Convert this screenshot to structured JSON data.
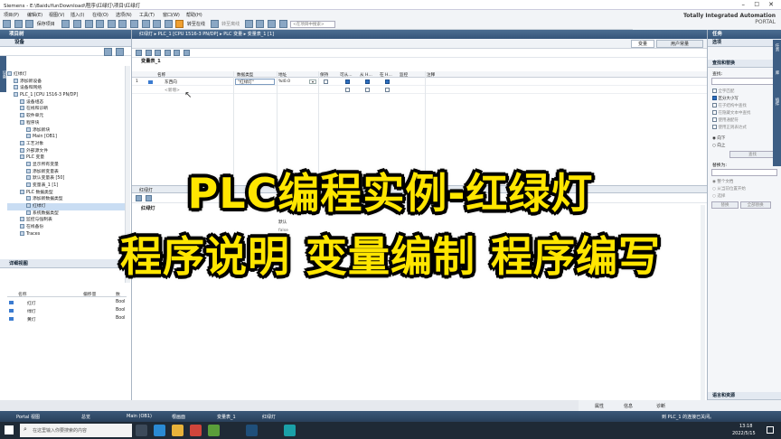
{
  "window": {
    "title": "Siemens  -  E:\\BaiduYunDownload\\程序\\红绿灯\\项目\\红绿灯",
    "brand_line1": "Totally Integrated Automation",
    "brand_line2": "PORTAL"
  },
  "menu": [
    "项目(P)",
    "编辑(E)",
    "视图(V)",
    "插入(I)",
    "在线(O)",
    "选项(N)",
    "工具(T)",
    "窗口(W)",
    "帮助(H)"
  ],
  "toolbar": {
    "save": "保存项目",
    "go_online": "转至在线",
    "go_offline": "转至离线",
    "search_placeholder": "<在项目中搜索>"
  },
  "left_panel": {
    "title": "项目树",
    "devices_label": "设备",
    "side_tab": "设备",
    "tree": [
      {
        "label": "红绿灯",
        "indent": 0,
        "selected": false
      },
      {
        "label": "添加新设备",
        "indent": 1,
        "selected": false
      },
      {
        "label": "设备和网络",
        "indent": 1,
        "selected": false
      },
      {
        "label": "PLC_1 [CPU 1516-3 PN/DP]",
        "indent": 1,
        "selected": false
      },
      {
        "label": "设备组态",
        "indent": 2,
        "selected": false
      },
      {
        "label": "在线和诊断",
        "indent": 2,
        "selected": false
      },
      {
        "label": "软件单元",
        "indent": 2,
        "selected": false
      },
      {
        "label": "程序块",
        "indent": 2,
        "selected": false
      },
      {
        "label": "添加新块",
        "indent": 3,
        "selected": false
      },
      {
        "label": "Main [OB1]",
        "indent": 3,
        "selected": false
      },
      {
        "label": "工艺对象",
        "indent": 2,
        "selected": false
      },
      {
        "label": "外部源文件",
        "indent": 2,
        "selected": false
      },
      {
        "label": "PLC 变量",
        "indent": 2,
        "selected": false
      },
      {
        "label": "显示所有变量",
        "indent": 3,
        "selected": false
      },
      {
        "label": "添加新变量表",
        "indent": 3,
        "selected": false
      },
      {
        "label": "默认变量表 [50]",
        "indent": 3,
        "selected": false
      },
      {
        "label": "变量表_1 [1]",
        "indent": 3,
        "selected": false
      },
      {
        "label": "PLC 数据类型",
        "indent": 2,
        "selected": false
      },
      {
        "label": "添加新数据类型",
        "indent": 3,
        "selected": false
      },
      {
        "label": "红绿灯",
        "indent": 3,
        "selected": true
      },
      {
        "label": "系统数据类型",
        "indent": 3,
        "selected": false
      },
      {
        "label": "监控与强制表",
        "indent": 2,
        "selected": false
      },
      {
        "label": "在线备份",
        "indent": 2,
        "selected": false
      },
      {
        "label": "Traces",
        "indent": 2,
        "selected": false
      }
    ],
    "details_title": "详细视图",
    "details_headers": [
      "名称",
      "偏移量",
      "数"
    ],
    "details_rows": [
      {
        "name": "红灯",
        "type": "Bool"
      },
      {
        "name": "绿灯",
        "type": "Bool"
      },
      {
        "name": "黄灯",
        "type": "Bool"
      }
    ]
  },
  "editor": {
    "breadcrumb": "红绿灯  ▸  PLC_1 [CPU 1516-3 PN/DP]  ▸  PLC 变量  ▸  变量表_1 [1]",
    "tab_vars": "变量",
    "tab_user_consts": "用户常量",
    "table_title": "变量表_1",
    "columns": [
      "名称",
      "数据类型",
      "地址",
      "保持",
      "可从...",
      "从 H...",
      "在 H...",
      "监控",
      "注释"
    ],
    "row1": {
      "num": "1",
      "name": "东西向",
      "type": "\"红绿灯\"",
      "addr": "%I0.0"
    },
    "add_new": "<新增>",
    "lower_breadcrumb": "红绿灯",
    "lower_title": "红绿灯",
    "lower_col": "默认",
    "lower_rows": [
      "false",
      "false",
      "false"
    ]
  },
  "right_panel": {
    "title": "任务",
    "options_label": "选项",
    "section": "查找和替换",
    "find_label": "查找:",
    "checks": [
      "全字匹配",
      "区分大小写",
      "在子结构中查找",
      "在隐藏文本中查找",
      "使用通配符",
      "使用正则表达式"
    ],
    "radios": [
      "向下",
      "向上"
    ],
    "find_button": "查找",
    "replace_label": "替换为:",
    "scope": [
      "整个文档",
      "从当前位置开始",
      "选择"
    ],
    "replace_button": "替换",
    "replace_all_button": "全部替换",
    "side_tabs": [
      "任务",
      "库",
      "插件"
    ],
    "bottom": "语言和资源"
  },
  "inspector": {
    "properties": "属性",
    "info": "信息",
    "diagnostics": "诊断"
  },
  "portal_bar": {
    "portal_view": "Portal 视图",
    "overview": "总览",
    "tabs": [
      "Main (OB1)",
      "根画面",
      "变量表_1",
      "红绿灯"
    ],
    "status": "到 PLC_1 的连接已关闭。"
  },
  "taskbar": {
    "search_placeholder": "在这里输入你要搜索的内容",
    "time": "13:18",
    "date": "2022/5/15"
  },
  "overlay": {
    "line1": "PLC编程实例-红绿灯",
    "line2": "程序说明 变量编制 程序编写"
  }
}
